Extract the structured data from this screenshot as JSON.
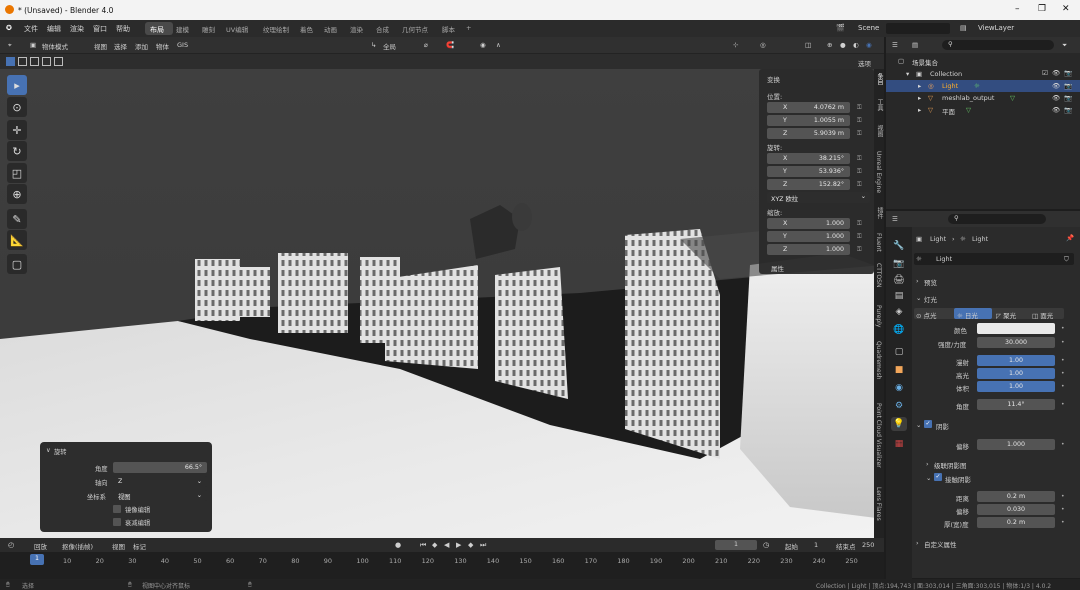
{
  "window": {
    "title": "* (Unsaved) - Blender 4.0",
    "minimize": "–",
    "maximize": "❐",
    "close": "✕"
  },
  "menu": {
    "items": [
      "文件",
      "编辑",
      "渲染",
      "窗口",
      "帮助"
    ],
    "workspaces": [
      "布局",
      "建模",
      "雕刻",
      "UV编辑",
      "纹理绘制",
      "着色",
      "动画",
      "渲染",
      "合成",
      "几何节点",
      "脚本",
      "+"
    ],
    "scene": "Scene",
    "view_layer": "ViewLayer"
  },
  "viewport_header": {
    "mode": "物体模式",
    "menus": [
      "视图",
      "选择",
      "添加",
      "物体",
      "GIS"
    ],
    "transform_orientation": "全局",
    "options": "选项"
  },
  "transform_panel": {
    "title": "变换",
    "location_label": "位置:",
    "location": [
      {
        "axis": "X",
        "value": "4.0762 m"
      },
      {
        "axis": "Y",
        "value": "1.0055 m"
      },
      {
        "axis": "Z",
        "value": "5.9039 m"
      }
    ],
    "rotation_label": "旋转:",
    "rotation": [
      {
        "axis": "X",
        "value": "38.215°"
      },
      {
        "axis": "Y",
        "value": "53.936°"
      },
      {
        "axis": "Z",
        "value": "152.82°"
      }
    ],
    "rotation_mode": "XYZ 欧拉",
    "scale_label": "缩放:",
    "scale": [
      {
        "axis": "X",
        "value": "1.000"
      },
      {
        "axis": "Y",
        "value": "1.000"
      },
      {
        "axis": "Z",
        "value": "1.000"
      }
    ],
    "properties_label": "属性"
  },
  "side_tabs": [
    "条目",
    "工具",
    "视图",
    "Unreal Engine",
    "插件",
    "Fluent",
    "CTTOSN",
    "Pureply",
    "Quadremesh",
    "Point Cloud Visualizer",
    "Lens Flares"
  ],
  "rotate_panel": {
    "title": "旋转",
    "angle_label": "角度",
    "angle_value": "66.5°",
    "axis_label": "轴向",
    "axis_value": "Z",
    "orient_label": "坐标系",
    "orient_value": "视图",
    "cb1": "镜像编辑",
    "cb2": "衰减编辑"
  },
  "timeline": {
    "menus": [
      "回放",
      "抠像(插帧)",
      "视图",
      "标记"
    ],
    "current_frame": "1",
    "start_label": "起始",
    "start": "1",
    "end_label": "结束点",
    "end": "250",
    "ruler": [
      "10",
      "20",
      "30",
      "40",
      "50",
      "60",
      "70",
      "80",
      "90",
      "100",
      "110",
      "120",
      "130",
      "140",
      "150",
      "160",
      "170",
      "180",
      "190",
      "200",
      "210",
      "220",
      "230",
      "240",
      "250"
    ],
    "cursor_frame": "1"
  },
  "status": {
    "left": "选择",
    "mid": "视图中心对齐鼠标",
    "right": "Collection | Light | 顶点:194,743 | 面:303,014 | 三角面:303,015 | 物体:1/3 | 4.0.2"
  },
  "outliner": {
    "scene_collection": "场景集合",
    "items": [
      "Collection",
      "Light",
      "meshlab_output",
      "平面"
    ]
  },
  "properties": {
    "breadcrumb_obj": "Light",
    "breadcrumb_data": "Light",
    "datablock": "Light",
    "preview": "预览",
    "light_section": "灯光",
    "light_types": [
      "点光",
      "日光",
      "聚光",
      "面光"
    ],
    "color_label": "颜色",
    "strength_label": "强度/力度",
    "strength": "30.000",
    "diffuse_label": "漫射",
    "diffuse": "1.00",
    "specular_label": "高光",
    "specular": "1.00",
    "volume_label": "体积",
    "volume": "1.00",
    "angle_label": "角度",
    "angle": "11.4°",
    "shadow_section": "阴影",
    "bias_label": "偏移",
    "bias": "1.000",
    "cascade_label": "级联阴影图",
    "contact_label": "接触阴影",
    "distance_label": "距离",
    "distance": "0.2 m",
    "cbias_label": "偏移",
    "cbias": "0.030",
    "thickness_label": "厚(宽)度",
    "thickness": "0.2 m",
    "custom_props": "自定义属性"
  }
}
